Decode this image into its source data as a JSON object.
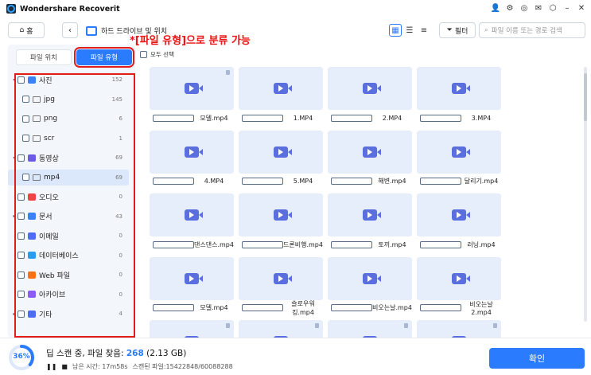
{
  "app": {
    "title": "Wondershare Recoverit"
  },
  "toolbar": {
    "home_label": "홈",
    "location_label": "하드 드라이브 및 위치",
    "filter_label": "필터",
    "search_placeholder": "파일 이름 또는 경로 검색"
  },
  "annotation": {
    "text": "*[파일 유형]으로 분류 가능"
  },
  "tabs": {
    "location": "파일 위치",
    "type": "파일 유형"
  },
  "select_all": "모두 선택",
  "tree": [
    {
      "label": "사진",
      "count": "152",
      "icon_color": "#3b82f6",
      "level": 0,
      "expander": "▾"
    },
    {
      "label": "jpg",
      "count": "145",
      "level": 1
    },
    {
      "label": "png",
      "count": "6",
      "level": 1
    },
    {
      "label": "scr",
      "count": "1",
      "level": 1
    },
    {
      "label": "동영상",
      "count": "69",
      "icon_color": "#6d5be6",
      "level": 0,
      "expander": "▾"
    },
    {
      "label": "mp4",
      "count": "69",
      "level": 1,
      "selected": true
    },
    {
      "label": "오디오",
      "count": "0",
      "icon_color": "#ef4444",
      "level": 0
    },
    {
      "label": "문서",
      "count": "43",
      "icon_color": "#3b82f6",
      "level": 0,
      "expander": "▸"
    },
    {
      "label": "이메일",
      "count": "0",
      "icon_color": "#4f6df5",
      "level": 0
    },
    {
      "label": "데이터베이스",
      "count": "0",
      "icon_color": "#2b9df0",
      "level": 0
    },
    {
      "label": "Web 파일",
      "count": "0",
      "icon_color": "#f97316",
      "level": 0
    },
    {
      "label": "아카이브",
      "count": "0",
      "icon_color": "#8b5cf6",
      "level": 0
    },
    {
      "label": "기타",
      "count": "4",
      "icon_color": "#4f6df5",
      "level": 0,
      "expander": "▸"
    }
  ],
  "files": [
    "모델.mp4",
    "1.MP4",
    "2.MP4",
    "3.MP4",
    "4.MP4",
    "5.MP4",
    "해변.mp4",
    "달리기.mp4",
    "댄스댄스.mp4",
    "드론비행.mp4",
    "토끼.mp4",
    "러닝.mp4",
    "모델.mp4",
    "슬로우워킹.mp4",
    "비오는날.mp4",
    "비오는날2.mp4"
  ],
  "footer": {
    "progress": "36%",
    "progress_value": 0.36,
    "status_prefix": "딥 스캔 중, 파일 찾음: ",
    "found_count": "268",
    "found_size": " (2.13 GB)",
    "time_left": "남은 시간: 17m58s",
    "scanned": "스캔된 파일:15422848/60088288",
    "confirm_label": "확인"
  },
  "colors": {
    "accent": "#2b7bff",
    "annotation": "#e21b1b"
  }
}
